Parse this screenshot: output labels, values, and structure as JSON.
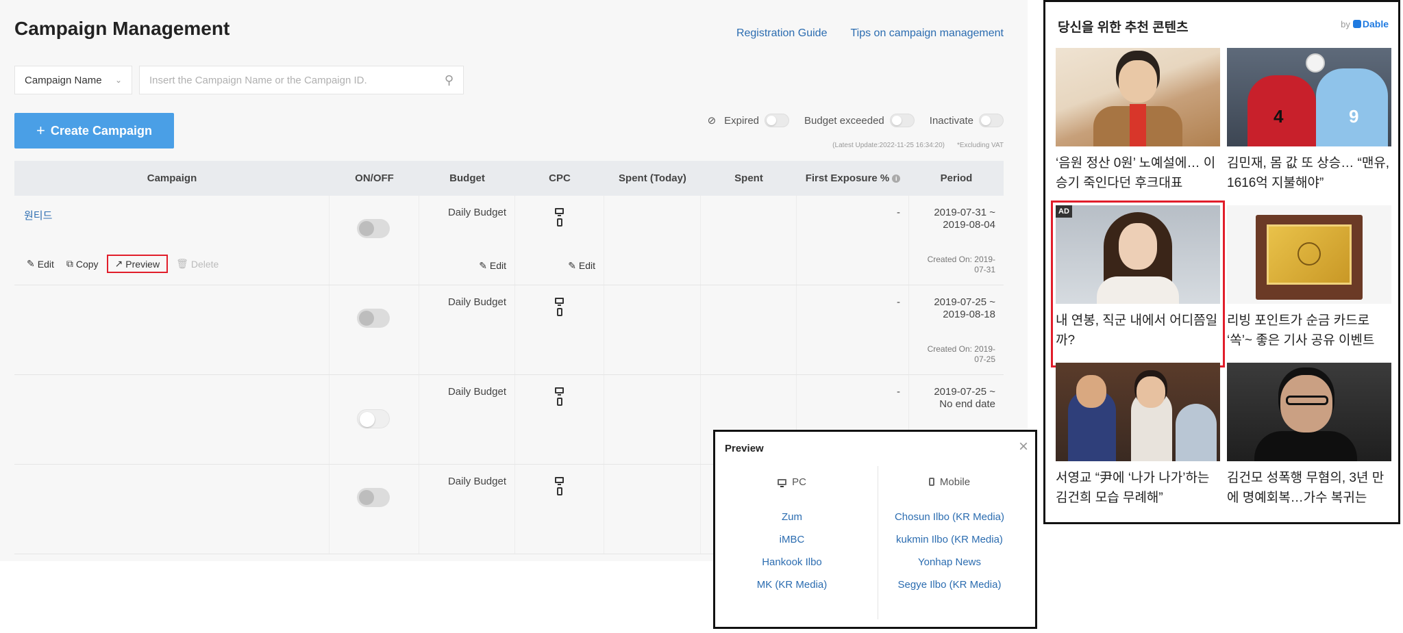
{
  "header": {
    "title": "Campaign Management",
    "links": [
      "Registration Guide",
      "Tips on campaign management"
    ]
  },
  "search": {
    "select_value": "Campaign Name",
    "placeholder": "Insert the Campaign Name or the Campaign ID."
  },
  "create_button": {
    "label": "Create Campaign"
  },
  "filters": {
    "expired": "Expired",
    "budget_exceeded": "Budget exceeded",
    "inactivate": "Inactivate"
  },
  "meta": {
    "latest_update": "(Latest Update:2022-11-25 16:34:20)",
    "vat_note": "*Excluding VAT"
  },
  "table": {
    "columns": [
      "Campaign",
      "ON/OFF",
      "Budget",
      "CPC",
      "Spent (Today)",
      "Spent",
      "First Exposure %",
      "Period"
    ],
    "rows": [
      {
        "name": "원티드",
        "budget": "Daily Budget",
        "first_exposure": "-",
        "period_start": "2019-07-31 ~",
        "period_end": "2019-08-04",
        "created": "Created On: 2019-07-31"
      },
      {
        "name": "",
        "budget": "Daily Budget",
        "first_exposure": "-",
        "period_start": "2019-07-25 ~",
        "period_end": "2019-08-18",
        "created": "Created On: 2019-07-25"
      },
      {
        "name": "",
        "budget": "Daily Budget",
        "first_exposure": "-",
        "period_start": "2019-07-25 ~",
        "period_end": "No end date",
        "created": ""
      },
      {
        "name": "",
        "budget": "Daily Budget",
        "first_exposure": "",
        "period_start": "",
        "period_end": "",
        "created": ""
      }
    ],
    "row_actions": {
      "edit": "Edit",
      "copy": "Copy",
      "preview": "Preview",
      "delete": "Delete"
    },
    "cell_edit": "Edit"
  },
  "preview_popup": {
    "title": "Preview",
    "pc_label": "PC",
    "mobile_label": "Mobile",
    "pc_media": [
      "Zum",
      "iMBC",
      "Hankook Ilbo",
      "MK (KR Media)"
    ],
    "mobile_media": [
      "Chosun Ilbo (KR Media)",
      "kukmin Ilbo (KR Media)",
      "Yonhap News",
      "Segye Ilbo (KR Media)"
    ]
  },
  "widget": {
    "title": "당신을 위한 추천 콘텐츠",
    "by": "by",
    "brand": "Dable",
    "ad_badge": "AD",
    "cards": [
      "‘음원 정산 0원’ 노예설에… 이승기 죽인다던 후크대표",
      "김민재, 몸 값 또 상승… “맨유, 1616억 지불해야”",
      "내 연봉, 직군 내에서 어디쯤일까?",
      "리빙 포인트가 순금 카드로 ‘쏙’~ 좋은 기사 공유 이벤트",
      "서영교 “尹에 ‘나가 나가’하는 김건희 모습 무례해”",
      "김건모 성폭행 무혐의, 3년 만에 명예회복…가수 복귀는"
    ]
  },
  "colors": {
    "accent_blue": "#4a9fe6",
    "link_blue": "#2b6cb0",
    "highlight_red": "#e11d2a",
    "dable_blue": "#1f7ae0"
  }
}
